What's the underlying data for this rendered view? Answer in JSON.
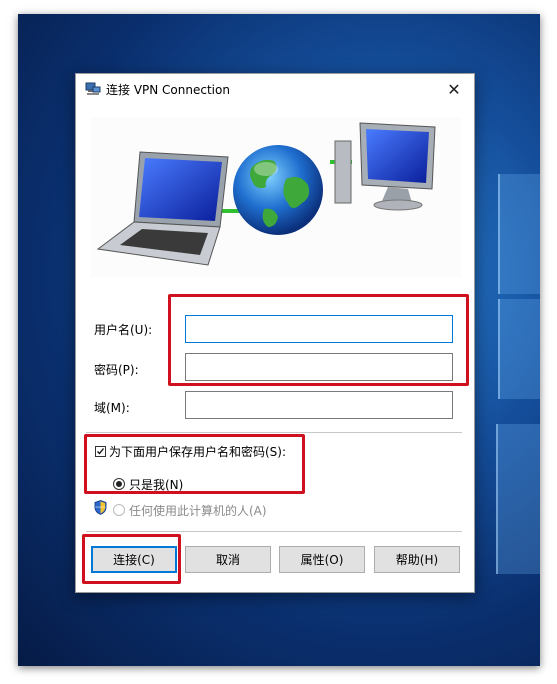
{
  "dialog": {
    "title": "连接 VPN Connection",
    "close_glyph": "✕"
  },
  "form": {
    "username_label": "用户名(U):",
    "username_value": "",
    "password_label": "密码(P):",
    "password_value": "",
    "domain_label": "域(M):",
    "domain_value": ""
  },
  "options": {
    "save_credentials_label": "为下面用户保存用户名和密码(S):",
    "save_credentials_checked": true,
    "only_me_label": "只是我(N)",
    "anyone_label": "任何使用此计算机的人(A)"
  },
  "buttons": {
    "connect": "连接(C)",
    "cancel": "取消",
    "properties": "属性(O)",
    "help": "帮助(H)"
  },
  "colors": {
    "highlight_box": "#d0101e",
    "accent": "#0078d7"
  },
  "icons": [
    "network-connection-icon",
    "close-icon",
    "laptop-icon",
    "globe-icon",
    "desktop-computer-icon",
    "uac-shield-icon"
  ]
}
